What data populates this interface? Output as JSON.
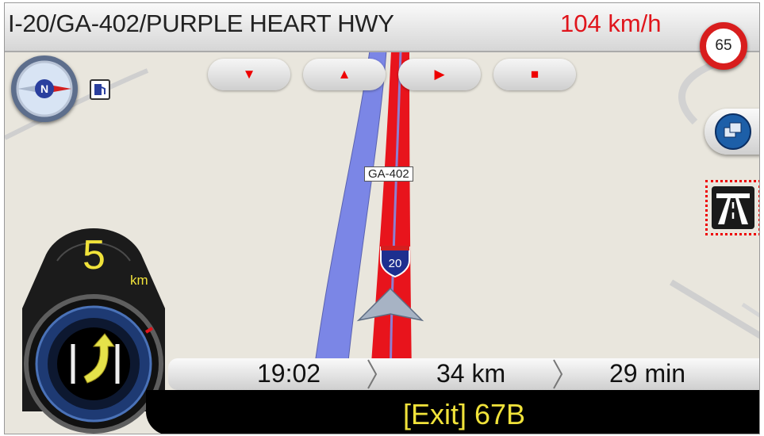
{
  "header": {
    "street": "I-20/GA-402/PURPLE HEART HWY",
    "speed": "104 km/h",
    "speed_limit": "65"
  },
  "map_controls": [
    {
      "name": "zoom-out-button",
      "glyph": "▼"
    },
    {
      "name": "zoom-in-button",
      "glyph": "▲"
    },
    {
      "name": "play-button",
      "glyph": "▶"
    },
    {
      "name": "stop-button",
      "glyph": "■"
    }
  ],
  "compass": {
    "label": "N"
  },
  "map": {
    "road_label": "GA-402",
    "interstate_shield": "20"
  },
  "guidance": {
    "distance": "5",
    "distance_unit": "km"
  },
  "trip": {
    "arrival_time": "19:02",
    "remaining_distance": "34 km",
    "remaining_time": "29 min"
  },
  "next_exit": {
    "label": "[Exit] 67B"
  },
  "colors": {
    "route": "#e8141c",
    "road": "#7b86e6",
    "speed_text": "#e0151c",
    "highlight": "#f0e23a"
  }
}
